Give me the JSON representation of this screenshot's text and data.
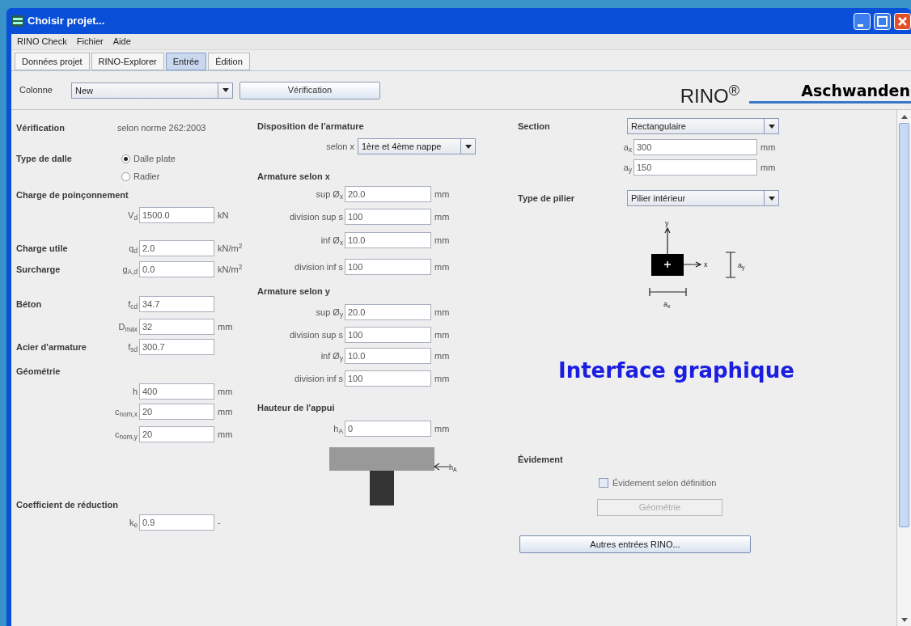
{
  "window": {
    "title": "Choisir projet..."
  },
  "menu": [
    {
      "label": "RINO Check"
    },
    {
      "label": "Fichier"
    },
    {
      "label": "Aide"
    }
  ],
  "tabs": [
    {
      "label": "Données projet",
      "selected": false
    },
    {
      "label": "RINO-Explorer",
      "selected": false
    },
    {
      "label": "Entrée",
      "selected": true
    },
    {
      "label": "Édition",
      "selected": false
    }
  ],
  "toolbar": {
    "label": "Colonne",
    "dropdown": "New",
    "button": "Vérification"
  },
  "logo": {
    "product": "RINO$^{®}$",
    "company": "Aschwanden"
  },
  "columns": [
    {
      "rows": [
        {
          "kind": "info",
          "label": "Vérification",
          "value": "selon norme 262:2003"
        },
        {
          "kind": "radio",
          "label": "Type de dalle",
          "options": [
            {
              "label": "Dalle plate",
              "selected": true
            },
            {
              "label": "Radier",
              "selected": false
            }
          ]
        },
        {
          "kind": "heading",
          "label": "Charge de poinçonnement"
        },
        {
          "kind": "field",
          "prefix": "V$_{d}$",
          "value": "1500.0",
          "unit": "kN"
        },
        {
          "kind": "field",
          "label": "Charge utile",
          "prefix": "q$_{d}$",
          "value": "2.0",
          "unit": "kN/m$^{2}$"
        },
        {
          "kind": "field",
          "label": "Surcharge",
          "prefix": "g$_{A,d}$",
          "value": "0.0",
          "unit": "kN/m$^{2}$"
        },
        {
          "kind": "field",
          "label": "Béton",
          "prefix": "f$_{cd}$",
          "value": "34.7"
        },
        {
          "kind": "field",
          "prefix": "D$_{max}$",
          "value": "32",
          "unit": "mm"
        },
        {
          "kind": "field",
          "label": "Acier d'armature",
          "prefix": "f$_{sd}$",
          "value": "300.7"
        },
        {
          "kind": "heading",
          "label": "Géométrie"
        },
        {
          "kind": "field",
          "prefix": "h",
          "value": "400",
          "unit": "mm"
        },
        {
          "kind": "field",
          "prefix": "c$_{nom,x}$",
          "value": "20",
          "unit": "mm"
        },
        {
          "kind": "field",
          "prefix": "c$_{nom,y}$",
          "value": "20",
          "unit": "mm"
        },
        {
          "kind": "heading",
          "label": "Coefficient de réduction"
        },
        {
          "kind": "field",
          "prefix": "k$_{e}$",
          "value": "0.9",
          "unit": "-"
        }
      ]
    },
    {
      "rows": [
        {
          "kind": "heading",
          "label": "Disposition de l'armature"
        },
        {
          "kind": "dropdown",
          "prefix": "selon x",
          "value": "1ère et 4ème nappe"
        },
        {
          "kind": "heading",
          "label": "Armature selon x"
        },
        {
          "kind": "field",
          "prefix": "sup Ø$_{x}$",
          "value": "20.0",
          "unit": "mm"
        },
        {
          "kind": "field",
          "prefix": "division sup s",
          "value": "100",
          "unit": "mm"
        },
        {
          "kind": "field",
          "prefix": "inf Ø$_{x}$",
          "value": "10.0",
          "unit": "mm"
        },
        {
          "kind": "field",
          "prefix": "division inf s",
          "value": "100",
          "unit": "mm"
        },
        {
          "kind": "heading",
          "label": "Armature selon y"
        },
        {
          "kind": "field",
          "prefix": "sup Ø$_{y}$",
          "value": "20.0",
          "unit": "mm"
        },
        {
          "kind": "field",
          "prefix": "division sup s",
          "value": "100",
          "unit": "mm"
        },
        {
          "kind": "field",
          "prefix": "inf Ø$_{y}$",
          "value": "10.0",
          "unit": "mm"
        },
        {
          "kind": "field",
          "prefix": "division inf s",
          "value": "100",
          "unit": "mm"
        },
        {
          "kind": "heading",
          "label": "Hauteur de l'appui"
        },
        {
          "kind": "field",
          "prefix": "h$_{A}$",
          "value": "0",
          "unit": "mm"
        },
        {
          "kind": "support_drawing",
          "labels": [
            "h$_{A}$"
          ]
        }
      ]
    },
    {
      "rows": [
        {
          "kind": "dropdown",
          "label": "Section",
          "value": "Rectangulaire"
        },
        {
          "kind": "field",
          "prefix": "a$_{x}$",
          "value": "300",
          "unit": "mm"
        },
        {
          "kind": "field",
          "prefix": "a$_{y}$",
          "value": "150",
          "unit": "mm"
        },
        {
          "kind": "dropdown",
          "label": "Type de pilier",
          "value": "Pilier intérieur"
        },
        {
          "kind": "section_drawing",
          "labels": [
            "y",
            "x",
            "a$_{x}$",
            "a$_{y}$"
          ]
        },
        {
          "kind": "annotation",
          "label": "Interface graphique"
        },
        {
          "kind": "heading",
          "label": "Évidement"
        },
        {
          "kind": "checkbox",
          "label": "Évidement selon définition",
          "checked": false
        },
        {
          "kind": "button",
          "label": "Géométrie",
          "disabled": true
        },
        {
          "kind": "button",
          "label": "Autres entrées RINO...",
          "disabled": false
        }
      ]
    }
  ]
}
